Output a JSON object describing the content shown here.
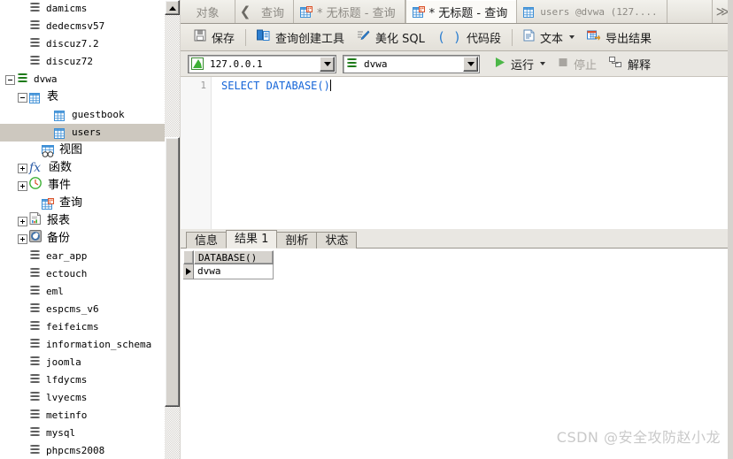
{
  "sidebar": {
    "tree": [
      {
        "label": "damicms",
        "icon": "database-icon",
        "indent": 1,
        "expander": "none",
        "selected": false,
        "cjk": false
      },
      {
        "label": "dedecmsv57",
        "icon": "database-icon",
        "indent": 1,
        "expander": "none",
        "selected": false,
        "cjk": false
      },
      {
        "label": "discuz7.2",
        "icon": "database-icon",
        "indent": 1,
        "expander": "none",
        "selected": false,
        "cjk": false
      },
      {
        "label": "discuz72",
        "icon": "database-icon",
        "indent": 1,
        "expander": "none",
        "selected": false,
        "cjk": false
      },
      {
        "label": "dvwa",
        "icon": "database-icon-open",
        "indent": 0,
        "expander": "minus",
        "selected": false,
        "cjk": false
      },
      {
        "label": "表",
        "icon": "table-folder-icon",
        "indent": 1,
        "expander": "minus",
        "selected": false,
        "cjk": true
      },
      {
        "label": "guestbook",
        "icon": "table-icon",
        "indent": 3,
        "expander": "none",
        "selected": false,
        "cjk": false
      },
      {
        "label": "users",
        "icon": "table-icon",
        "indent": 3,
        "expander": "none",
        "selected": true,
        "cjk": false
      },
      {
        "label": "视图",
        "icon": "view-icon",
        "indent": 2,
        "expander": "none",
        "selected": false,
        "cjk": true
      },
      {
        "label": "函数",
        "icon": "function-icon",
        "indent": 1,
        "expander": "plus",
        "selected": false,
        "cjk": true
      },
      {
        "label": "事件",
        "icon": "event-icon",
        "indent": 1,
        "expander": "plus",
        "selected": false,
        "cjk": true
      },
      {
        "label": "查询",
        "icon": "query-icon",
        "indent": 2,
        "expander": "none",
        "selected": false,
        "cjk": true
      },
      {
        "label": "报表",
        "icon": "report-icon",
        "indent": 1,
        "expander": "plus",
        "selected": false,
        "cjk": true
      },
      {
        "label": "备份",
        "icon": "backup-icon",
        "indent": 1,
        "expander": "plus",
        "selected": false,
        "cjk": true
      },
      {
        "label": "ear_app",
        "icon": "database-icon",
        "indent": 1,
        "expander": "none",
        "selected": false,
        "cjk": false
      },
      {
        "label": "ectouch",
        "icon": "database-icon",
        "indent": 1,
        "expander": "none",
        "selected": false,
        "cjk": false
      },
      {
        "label": "eml",
        "icon": "database-icon",
        "indent": 1,
        "expander": "none",
        "selected": false,
        "cjk": false
      },
      {
        "label": "espcms_v6",
        "icon": "database-icon",
        "indent": 1,
        "expander": "none",
        "selected": false,
        "cjk": false
      },
      {
        "label": "feifeicms",
        "icon": "database-icon",
        "indent": 1,
        "expander": "none",
        "selected": false,
        "cjk": false
      },
      {
        "label": "information_schema",
        "icon": "database-icon",
        "indent": 1,
        "expander": "none",
        "selected": false,
        "cjk": false
      },
      {
        "label": "joomla",
        "icon": "database-icon",
        "indent": 1,
        "expander": "none",
        "selected": false,
        "cjk": false
      },
      {
        "label": "lfdycms",
        "icon": "database-icon",
        "indent": 1,
        "expander": "none",
        "selected": false,
        "cjk": false
      },
      {
        "label": "lvyecms",
        "icon": "database-icon",
        "indent": 1,
        "expander": "none",
        "selected": false,
        "cjk": false
      },
      {
        "label": "metinfo",
        "icon": "database-icon",
        "indent": 1,
        "expander": "none",
        "selected": false,
        "cjk": false
      },
      {
        "label": "mysql",
        "icon": "database-icon",
        "indent": 1,
        "expander": "none",
        "selected": false,
        "cjk": false
      },
      {
        "label": "phpcms2008",
        "icon": "database-icon",
        "indent": 1,
        "expander": "none",
        "selected": false,
        "cjk": false
      }
    ]
  },
  "tabbar": {
    "objects_label": "对象",
    "back_glyph": "❮",
    "query_label": "查询",
    "tabs": [
      {
        "label": "* 无标题 - 查询",
        "icon": "query-tab-icon",
        "active": false,
        "mono": false
      },
      {
        "label": "* 无标题 - 查询",
        "icon": "query-tab-icon",
        "active": true,
        "mono": false
      },
      {
        "label": "users @dvwa (127....",
        "icon": "table-tab-icon",
        "active": false,
        "mono": true
      }
    ],
    "overflow_glyph": "≫"
  },
  "toolbar": {
    "save_label": "保存",
    "query_builder_label": "查询创建工具",
    "beautify_label": "美化 SQL",
    "snippet_label": "代码段",
    "text_label": "文本",
    "export_label": "导出结果"
  },
  "connection": {
    "host": "127.0.0.1",
    "database": "dvwa",
    "run_label": "运行",
    "stop_label": "停止",
    "explain_label": "解释"
  },
  "editor": {
    "line_number": "1",
    "sql_keyword": "SELECT",
    "sql_space": " ",
    "sql_function": "DATABASE",
    "sql_parens": "()"
  },
  "results": {
    "tabs": [
      {
        "label": "信息",
        "active": false
      },
      {
        "label": "结果 1",
        "active": true
      },
      {
        "label": "剖析",
        "active": false
      },
      {
        "label": "状态",
        "active": false
      }
    ],
    "grid": {
      "columns": [
        "DATABASE()"
      ],
      "rows": [
        [
          "dvwa"
        ]
      ]
    }
  },
  "watermark": {
    "text": "CSDN @安全攻防赵小龙"
  },
  "colors": {
    "accent_green": "#3cb034",
    "sql_blue": "#1565d8",
    "selection": "#cdc8bf",
    "chrome": "#d6d3ce"
  }
}
